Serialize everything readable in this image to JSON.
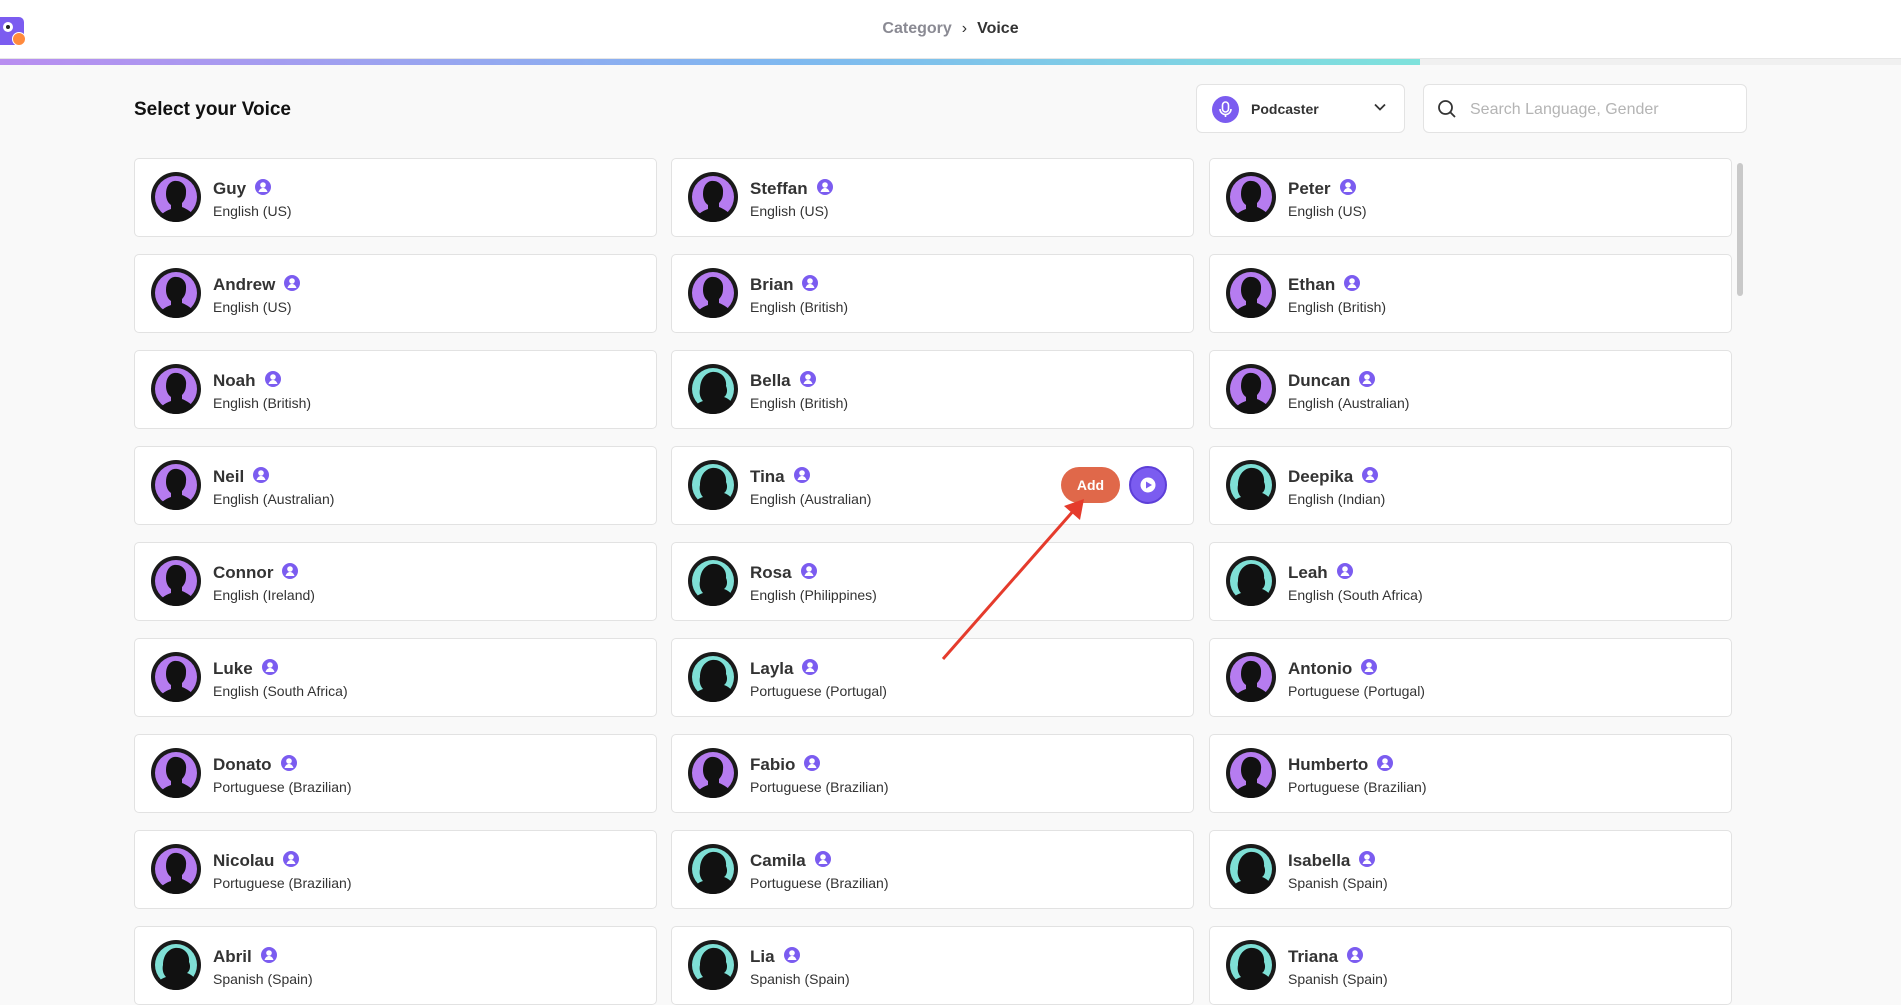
{
  "breadcrumb": {
    "category": "Category",
    "separator": "›",
    "current": "Voice"
  },
  "progress": {
    "percent": 74.7
  },
  "page": {
    "heading": "Select your Voice"
  },
  "category_select": {
    "selected": "Podcaster",
    "icon": "mic-icon"
  },
  "search": {
    "placeholder": "Search Language, Gender",
    "value": ""
  },
  "hovered_card": {
    "add_label": "Add",
    "play_icon": "play-icon"
  },
  "colors": {
    "accent": "#7b5cf0",
    "add": "#e0684a",
    "male_ring": "#b67cf0",
    "female_ring": "#7fe0d6"
  },
  "voices": [
    {
      "name": "Guy",
      "language": "English (US)",
      "gender": "male"
    },
    {
      "name": "Steffan",
      "language": "English (US)",
      "gender": "male"
    },
    {
      "name": "Peter",
      "language": "English (US)",
      "gender": "male"
    },
    {
      "name": "Andrew",
      "language": "English (US)",
      "gender": "male"
    },
    {
      "name": "Brian",
      "language": "English (British)",
      "gender": "male"
    },
    {
      "name": "Ethan",
      "language": "English (British)",
      "gender": "male"
    },
    {
      "name": "Noah",
      "language": "English (British)",
      "gender": "male"
    },
    {
      "name": "Bella",
      "language": "English (British)",
      "gender": "female"
    },
    {
      "name": "Duncan",
      "language": "English (Australian)",
      "gender": "male"
    },
    {
      "name": "Neil",
      "language": "English (Australian)",
      "gender": "male"
    },
    {
      "name": "Tina",
      "language": "English (Australian)",
      "gender": "female"
    },
    {
      "name": "Deepika",
      "language": "English (Indian)",
      "gender": "female"
    },
    {
      "name": "Connor",
      "language": "English (Ireland)",
      "gender": "male"
    },
    {
      "name": "Rosa",
      "language": "English (Philippines)",
      "gender": "female"
    },
    {
      "name": "Leah",
      "language": "English (South Africa)",
      "gender": "female"
    },
    {
      "name": "Luke",
      "language": "English (South Africa)",
      "gender": "male"
    },
    {
      "name": "Layla",
      "language": "Portuguese (Portugal)",
      "gender": "female"
    },
    {
      "name": "Antonio",
      "language": "Portuguese (Portugal)",
      "gender": "male"
    },
    {
      "name": "Donato",
      "language": "Portuguese (Brazilian)",
      "gender": "male"
    },
    {
      "name": "Fabio",
      "language": "Portuguese (Brazilian)",
      "gender": "male"
    },
    {
      "name": "Humberto",
      "language": "Portuguese (Brazilian)",
      "gender": "male"
    },
    {
      "name": "Nicolau",
      "language": "Portuguese (Brazilian)",
      "gender": "male"
    },
    {
      "name": "Camila",
      "language": "Portuguese (Brazilian)",
      "gender": "female"
    },
    {
      "name": "Isabella",
      "language": "Spanish (Spain)",
      "gender": "female"
    },
    {
      "name": "Abril",
      "language": "Spanish (Spain)",
      "gender": "female"
    },
    {
      "name": "Lia",
      "language": "Spanish (Spain)",
      "gender": "female"
    },
    {
      "name": "Triana",
      "language": "Spanish (Spain)",
      "gender": "female"
    }
  ]
}
